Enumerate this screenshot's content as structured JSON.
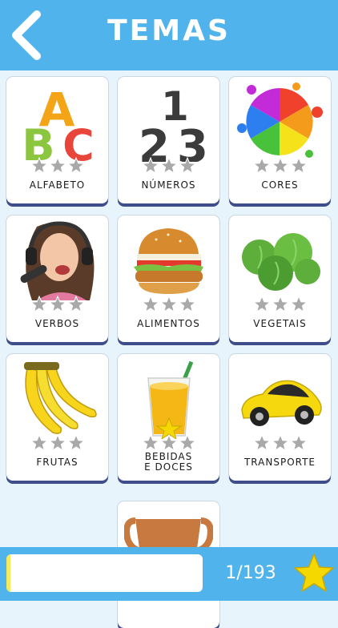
{
  "header": {
    "title": "TEMAS"
  },
  "topics": [
    {
      "label": "ALFABETO",
      "icon": "abc-letters-icon",
      "stars": 0
    },
    {
      "label": "NÚMEROS",
      "icon": "numbers-123-icon",
      "stars": 0
    },
    {
      "label": "CORES",
      "icon": "color-splash-icon",
      "stars": 0
    },
    {
      "label": "VERBOS",
      "icon": "singing-girl-image",
      "stars": 0
    },
    {
      "label": "ALIMENTOS",
      "icon": "burger-image",
      "stars": 0
    },
    {
      "label": "VEGETAIS",
      "icon": "cabbage-image",
      "stars": 0
    },
    {
      "label": "FRUTAS",
      "icon": "bananas-image",
      "stars": 0
    },
    {
      "label": "BEBIDAS\nE DOCES",
      "icon": "juice-glass-image",
      "stars": 0
    },
    {
      "label": "TRANSPORTE",
      "icon": "yellow-car-image",
      "stars": 0
    },
    {
      "label": "",
      "icon": "trophy-image",
      "stars": 0
    }
  ],
  "progress": {
    "count": "1/193",
    "fraction": 0.005
  },
  "colors": {
    "header": "#50b3ec",
    "background": "#e7f4fc",
    "card_shadow": "#3f4e8a",
    "star_empty": "#a9a9a9",
    "star_gold": "#f5d800"
  }
}
